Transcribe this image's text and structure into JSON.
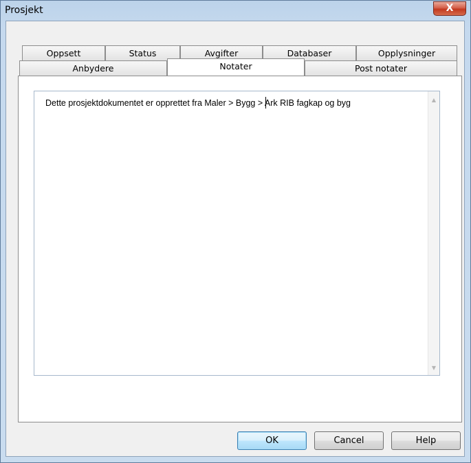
{
  "window": {
    "title": "Prosjekt",
    "close_label": "X"
  },
  "tabs": {
    "row1": [
      "Oppsett",
      "Status",
      "Avgifter",
      "Databaser",
      "Opplysninger"
    ],
    "row2": [
      "Anbydere",
      "Notater",
      "Post notater"
    ],
    "active": "Notater"
  },
  "notes": {
    "text": "Dette prosjektdokumentet er opprettet fra Maler > Bygg > Ark RIB fagkap og byg"
  },
  "buttons": {
    "ok": "OK",
    "cancel": "Cancel",
    "help": "Help"
  },
  "colors": {
    "window_frame": "#c5d9ee",
    "close_button": "#c2391f",
    "default_button_border": "#3c7fb1"
  }
}
